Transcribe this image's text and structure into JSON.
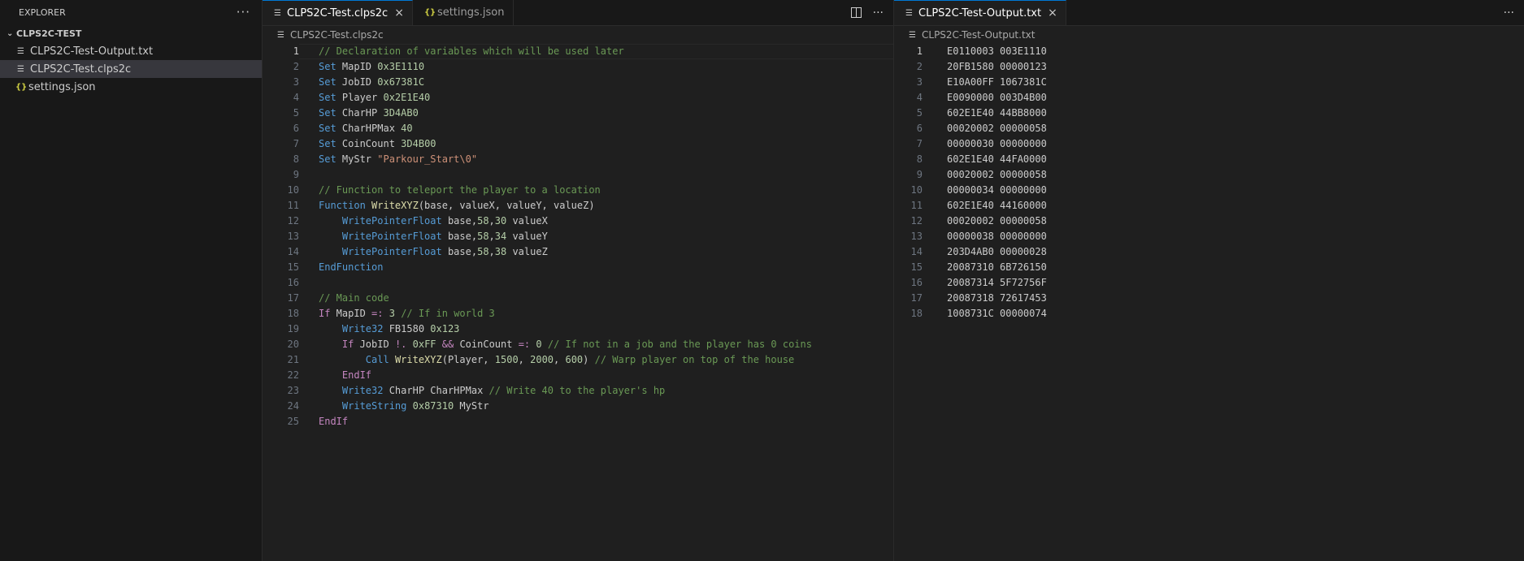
{
  "explorer": {
    "title": "EXPLORER",
    "more": "···",
    "section": "CLPS2C-TEST",
    "files": [
      {
        "name": "CLPS2C-Test-Output.txt",
        "icon": "file-lines-icon"
      },
      {
        "name": "CLPS2C-Test.clps2c",
        "icon": "file-lines-icon",
        "selected": true
      },
      {
        "name": "settings.json",
        "icon": "json-braces-icon"
      }
    ]
  },
  "editor_left": {
    "tabs": [
      {
        "label": "CLPS2C-Test.clps2c",
        "active": true,
        "close": "×"
      },
      {
        "label": "settings.json",
        "active": false,
        "icon": "{}"
      }
    ],
    "more": "···",
    "breadcrumb": "CLPS2C-Test.clps2c",
    "current_line": 1,
    "lines": [
      [
        [
          "c",
          "// Declaration of variables which will be used later"
        ]
      ],
      [
        [
          "k",
          "Set"
        ],
        [
          "w",
          " MapID "
        ],
        [
          "n",
          "0x3E1110"
        ]
      ],
      [
        [
          "k",
          "Set"
        ],
        [
          "w",
          " JobID "
        ],
        [
          "n",
          "0x67381C"
        ]
      ],
      [
        [
          "k",
          "Set"
        ],
        [
          "w",
          " Player "
        ],
        [
          "n",
          "0x2E1E40"
        ]
      ],
      [
        [
          "k",
          "Set"
        ],
        [
          "w",
          " CharHP "
        ],
        [
          "n",
          "3D4AB0"
        ]
      ],
      [
        [
          "k",
          "Set"
        ],
        [
          "w",
          " CharHPMax "
        ],
        [
          "n",
          "40"
        ]
      ],
      [
        [
          "k",
          "Set"
        ],
        [
          "w",
          " CoinCount "
        ],
        [
          "n",
          "3D4B00"
        ]
      ],
      [
        [
          "k",
          "Set"
        ],
        [
          "w",
          " MyStr "
        ],
        [
          "s",
          "\"Parkour_Start\\0\""
        ]
      ],
      [],
      [
        [
          "c",
          "// Function to teleport the player to a location"
        ]
      ],
      [
        [
          "k",
          "Function"
        ],
        [
          "w",
          " "
        ],
        [
          "f",
          "WriteXYZ"
        ],
        [
          "w",
          "(base, valueX, valueY, valueZ)"
        ]
      ],
      [
        [
          "w",
          "    "
        ],
        [
          "k",
          "WritePointerFloat"
        ],
        [
          "w",
          " base,"
        ],
        [
          "n",
          "58"
        ],
        [
          "w",
          ","
        ],
        [
          "n",
          "30"
        ],
        [
          "w",
          " valueX"
        ]
      ],
      [
        [
          "w",
          "    "
        ],
        [
          "k",
          "WritePointerFloat"
        ],
        [
          "w",
          " base,"
        ],
        [
          "n",
          "58"
        ],
        [
          "w",
          ","
        ],
        [
          "n",
          "34"
        ],
        [
          "w",
          " valueY"
        ]
      ],
      [
        [
          "w",
          "    "
        ],
        [
          "k",
          "WritePointerFloat"
        ],
        [
          "w",
          " base,"
        ],
        [
          "n",
          "58"
        ],
        [
          "w",
          ","
        ],
        [
          "n",
          "38"
        ],
        [
          "w",
          " valueZ"
        ]
      ],
      [
        [
          "k",
          "EndFunction"
        ]
      ],
      [],
      [
        [
          "c",
          "// Main code"
        ]
      ],
      [
        [
          "p",
          "If"
        ],
        [
          "w",
          " MapID "
        ],
        [
          "p",
          "=:"
        ],
        [
          "w",
          " "
        ],
        [
          "n",
          "3"
        ],
        [
          "w",
          " "
        ],
        [
          "c",
          "// If in world 3"
        ]
      ],
      [
        [
          "w",
          "    "
        ],
        [
          "k",
          "Write32"
        ],
        [
          "w",
          " FB1580 "
        ],
        [
          "n",
          "0x123"
        ]
      ],
      [
        [
          "w",
          "    "
        ],
        [
          "p",
          "If"
        ],
        [
          "w",
          " JobID "
        ],
        [
          "p",
          "!."
        ],
        [
          "w",
          " "
        ],
        [
          "n",
          "0xFF"
        ],
        [
          "w",
          " "
        ],
        [
          "p",
          "&&"
        ],
        [
          "w",
          " CoinCount "
        ],
        [
          "p",
          "=:"
        ],
        [
          "w",
          " "
        ],
        [
          "n",
          "0"
        ],
        [
          "w",
          " "
        ],
        [
          "c",
          "// If not in a job and the player has 0 coins"
        ]
      ],
      [
        [
          "w",
          "        "
        ],
        [
          "k",
          "Call"
        ],
        [
          "w",
          " "
        ],
        [
          "f",
          "WriteXYZ"
        ],
        [
          "w",
          "(Player, "
        ],
        [
          "n",
          "1500"
        ],
        [
          "w",
          ", "
        ],
        [
          "n",
          "2000"
        ],
        [
          "w",
          ", "
        ],
        [
          "n",
          "600"
        ],
        [
          "w",
          ") "
        ],
        [
          "c",
          "// Warp player on top of the house"
        ]
      ],
      [
        [
          "w",
          "    "
        ],
        [
          "p",
          "EndIf"
        ]
      ],
      [
        [
          "w",
          "    "
        ],
        [
          "k",
          "Write32"
        ],
        [
          "w",
          " CharHP CharHPMax "
        ],
        [
          "c",
          "// Write 40 to the player's hp"
        ]
      ],
      [
        [
          "w",
          "    "
        ],
        [
          "k",
          "WriteString"
        ],
        [
          "w",
          " "
        ],
        [
          "n",
          "0x87310"
        ],
        [
          "w",
          " MyStr"
        ]
      ],
      [
        [
          "p",
          "EndIf"
        ]
      ]
    ]
  },
  "editor_right": {
    "tabs": [
      {
        "label": "CLPS2C-Test-Output.txt",
        "active": true,
        "close": "×"
      }
    ],
    "more": "···",
    "breadcrumb": "CLPS2C-Test-Output.txt",
    "current_line": 1,
    "lines": [
      "E0110003 003E1110",
      "20FB1580 00000123",
      "E10A00FF 1067381C",
      "E0090000 003D4B00",
      "602E1E40 44BB8000",
      "00020002 00000058",
      "00000030 00000000",
      "602E1E40 44FA0000",
      "00020002 00000058",
      "00000034 00000000",
      "602E1E40 44160000",
      "00020002 00000058",
      "00000038 00000000",
      "203D4AB0 00000028",
      "20087310 6B726150",
      "20087314 5F72756F",
      "20087318 72617453",
      "1008731C 00000074"
    ]
  }
}
